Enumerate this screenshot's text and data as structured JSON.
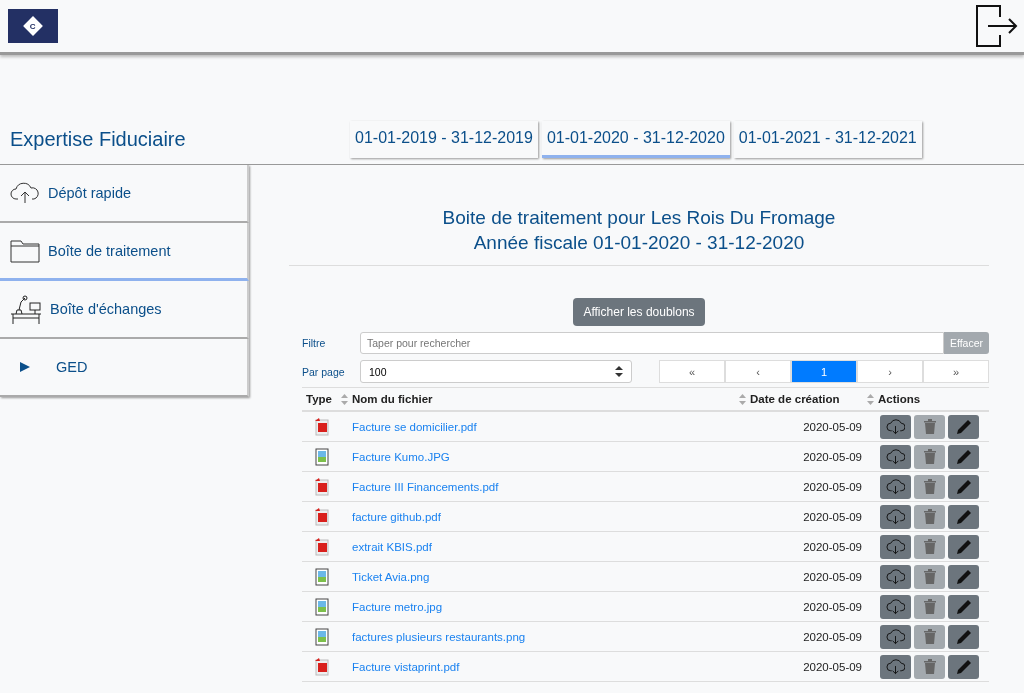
{
  "header": {
    "logo": "C"
  },
  "brand": "Expertise Fiduciaire",
  "period_tabs": [
    {
      "label": "01-01-2019 - 31-12-2019",
      "selected": false
    },
    {
      "label": "01-01-2020 - 31-12-2020",
      "selected": true
    },
    {
      "label": "01-01-2021 - 31-12-2021",
      "selected": false
    }
  ],
  "sidebar": {
    "items": [
      {
        "label": "Dépôt rapide",
        "kind": "upload",
        "selected": false
      },
      {
        "label": "Boîte de traitement",
        "kind": "folder",
        "selected": true
      },
      {
        "label": "Boîte d'échanges",
        "kind": "desk",
        "selected": false
      },
      {
        "label": "GED",
        "kind": "tree",
        "selected": false,
        "expanded": false
      }
    ]
  },
  "main": {
    "title": "Boite de traitement pour Les Rois Du Fromage",
    "subtitle": "Année fiscale 01-01-2020 - 31-12-2020",
    "duplicates_button": "Afficher les doublons",
    "filter": {
      "label": "Filtre",
      "placeholder": "Taper pour rechercher",
      "clear_button": "Effacer"
    },
    "per_page": {
      "label": "Par page",
      "value": "100"
    },
    "pagination": [
      {
        "label": "«",
        "selected": false
      },
      {
        "label": "‹",
        "selected": false
      },
      {
        "label": "1",
        "selected": true
      },
      {
        "label": "›",
        "selected": false
      },
      {
        "label": "»",
        "selected": false
      }
    ],
    "table": {
      "columns": [
        {
          "label": "Type",
          "sortable": true
        },
        {
          "label": "Nom du fichier",
          "sortable": true
        },
        {
          "label": "Date de création",
          "sortable": true
        },
        {
          "label": "Actions",
          "sortable": false
        }
      ],
      "rows": [
        {
          "kind": "pdf",
          "name": "Facture se domicilier.pdf",
          "date": "2020-05-09"
        },
        {
          "kind": "image",
          "name": "Facture Kumo.JPG",
          "date": "2020-05-09"
        },
        {
          "kind": "pdf",
          "name": "Facture III Financements.pdf",
          "date": "2020-05-09"
        },
        {
          "kind": "pdf",
          "name": "facture github.pdf",
          "date": "2020-05-09"
        },
        {
          "kind": "pdf",
          "name": "extrait KBIS.pdf",
          "date": "2020-05-09"
        },
        {
          "kind": "image",
          "name": "Ticket Avia.png",
          "date": "2020-05-09"
        },
        {
          "kind": "image",
          "name": "Facture metro.jpg",
          "date": "2020-05-09"
        },
        {
          "kind": "image",
          "name": "factures plusieurs restaurants.png",
          "date": "2020-05-09"
        },
        {
          "kind": "pdf",
          "name": "Facture vistaprint.pdf",
          "date": "2020-05-09"
        }
      ]
    }
  }
}
